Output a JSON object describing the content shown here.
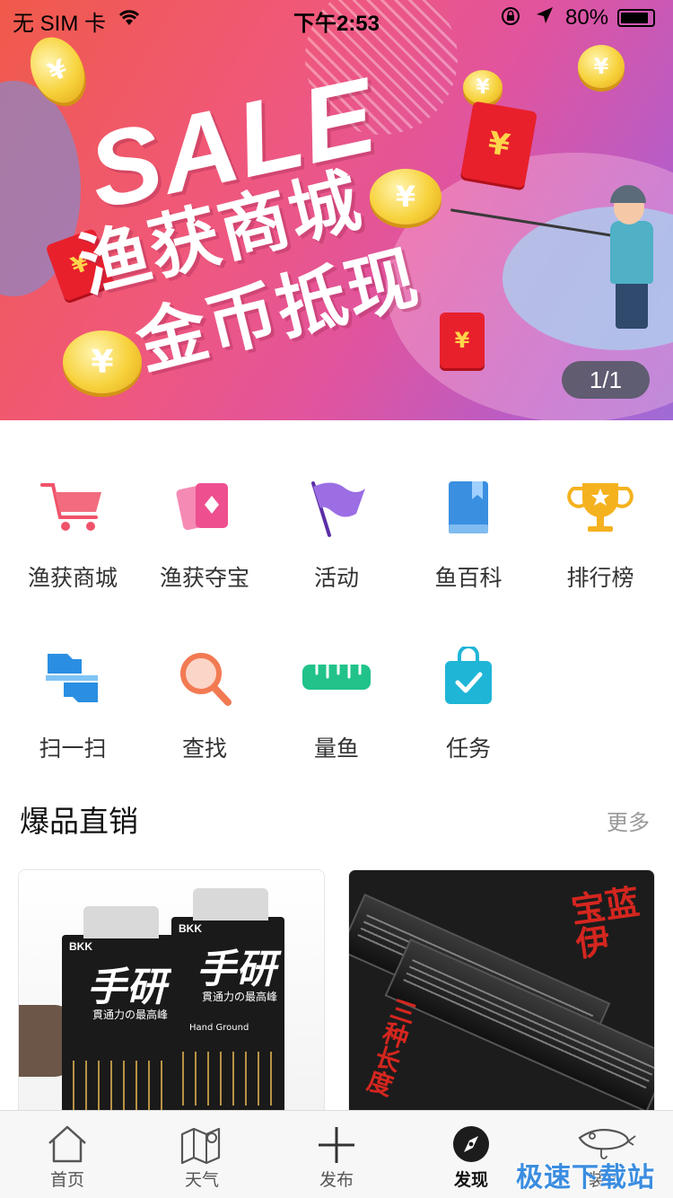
{
  "status_bar": {
    "carrier": "无 SIM 卡",
    "time": "下午2:53",
    "battery": "80%"
  },
  "banner": {
    "headline": "SALE",
    "line1": "渔获商城",
    "line2": "金币抵现",
    "coin_symbol": "¥",
    "pager": "1/1",
    "colors": {
      "gradient_start": "#f05a4a",
      "gradient_end": "#9f6bd6"
    }
  },
  "menu": {
    "items": [
      {
        "label": "渔获商城",
        "icon": "cart-icon"
      },
      {
        "label": "渔获夺宝",
        "icon": "cards-icon"
      },
      {
        "label": "活动",
        "icon": "flag-icon"
      },
      {
        "label": "鱼百科",
        "icon": "book-icon"
      },
      {
        "label": "排行榜",
        "icon": "trophy-icon"
      },
      {
        "label": "扫一扫",
        "icon": "scan-icon"
      },
      {
        "label": "查找",
        "icon": "search-icon"
      },
      {
        "label": "量鱼",
        "icon": "ruler-icon"
      },
      {
        "label": "任务",
        "icon": "task-bag-icon"
      }
    ]
  },
  "section": {
    "title": "爆品直销",
    "more": "更多"
  },
  "products": [
    {
      "brand": "BKK",
      "kanji": "手研",
      "sub": "貫通力の最高峰",
      "label": "Hand Ground"
    },
    {
      "kanji": "三种长度",
      "text": "宝蓝伊"
    }
  ],
  "tabbar": {
    "items": [
      {
        "label": "首页",
        "icon": "home-icon"
      },
      {
        "label": "天气",
        "icon": "weather-map-icon"
      },
      {
        "label": "发布",
        "icon": "plus-icon"
      },
      {
        "label": "发现",
        "icon": "compass-icon",
        "active": true
      },
      {
        "label": "装备",
        "icon": "fishing-lure-icon"
      }
    ]
  },
  "watermark": "极速下载站"
}
